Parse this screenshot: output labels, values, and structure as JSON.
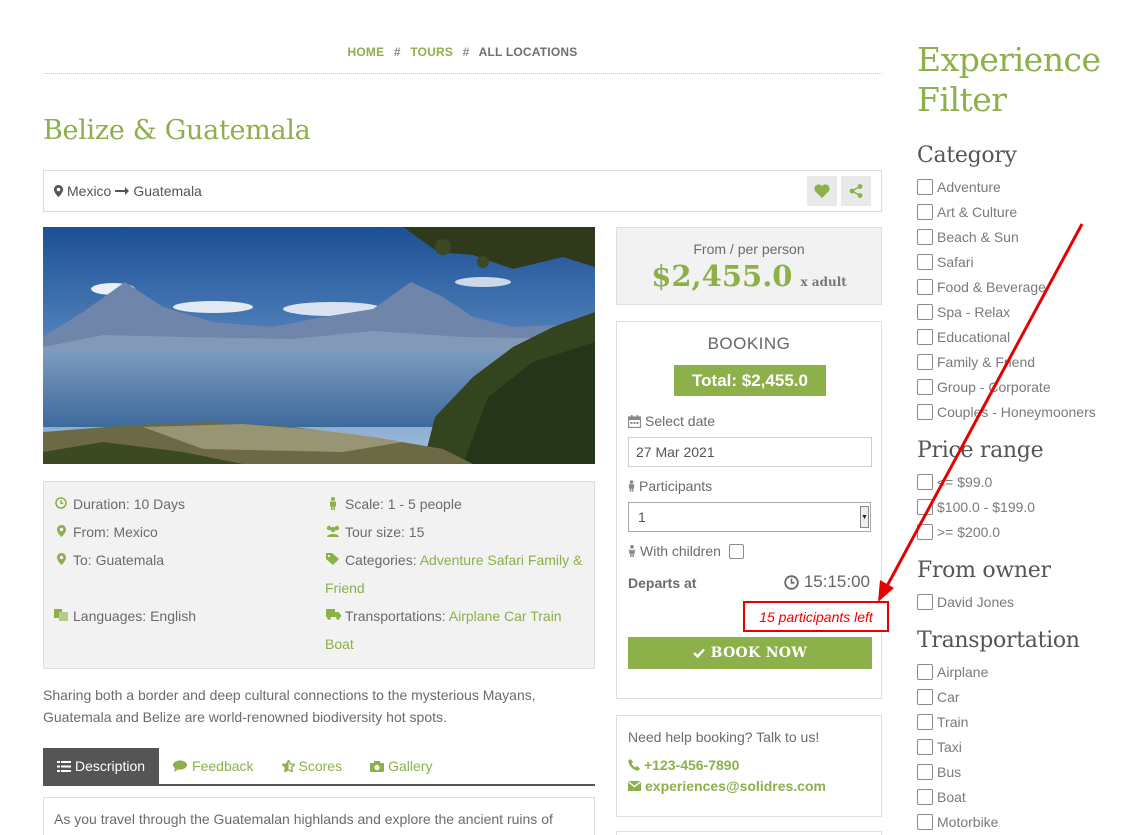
{
  "breadcrumb": {
    "home": "HOME",
    "sep": "#",
    "tours": "TOURS",
    "current": "ALL LOCATIONS"
  },
  "tour": {
    "title": "Belize & Guatemala",
    "route_from": "Mexico",
    "route_to": "Guatemala",
    "facts": {
      "duration": "Duration: 10 Days",
      "from": "From: Mexico",
      "to": "To: Guatemala",
      "languages": "Languages: English",
      "scale": "Scale: 1 - 5 people",
      "tour_size": "Tour size: 15",
      "categories_label": "Categories:",
      "categories_line1": "Adventure Safari Family &",
      "categories_line2": "Friend",
      "transport_label": "Transportations:",
      "transport_line1": "Airplane Car Train",
      "transport_line2": "Boat"
    },
    "intro_line1": "Sharing both a border and deep cultural connections to the mysterious Mayans,",
    "intro_line2": "Guatemala and Belize are world-renowned biodiversity hot spots.",
    "tabs": [
      "Description",
      "Feedback",
      "Scores",
      "Gallery"
    ],
    "description_start": "As you travel through the Guatemalan highlands and explore the ancient ruins of"
  },
  "price": {
    "from_label": "From / per person",
    "amount": "$2,455.0",
    "unit": "x adult"
  },
  "booking": {
    "title": "BOOKING",
    "total": "Total: $2,455.0",
    "select_date_label": "Select date",
    "date_value": "27 Mar 2021",
    "participants_label": "Participants",
    "participants_value": "1",
    "children_label": "With children",
    "departs_label": "Departs at",
    "departs_time": "15:15:00",
    "participants_left": "15 participants left",
    "book_now": "BOOK NOW"
  },
  "help": {
    "question": "Need help booking? Talk to us!",
    "phone": "+123-456-7890",
    "email": "experiences@solidres.com"
  },
  "filter": {
    "title_line1": "Experience",
    "title_line2": "Filter",
    "category_heading": "Category",
    "categories": [
      "Adventure",
      "Art & Culture",
      "Beach & Sun",
      "Safari",
      "Food & Beverage",
      "Spa - Relax",
      "Educational",
      "Family & Friend",
      "Group - Corporate",
      "Couples - Honeymooners"
    ],
    "price_heading": "Price range",
    "prices": [
      "<= $99.0",
      "$100.0 - $199.0",
      ">= $200.0"
    ],
    "owner_heading": "From owner",
    "owners": [
      "David Jones"
    ],
    "transport_heading": "Transportation",
    "transports": [
      "Airplane",
      "Car",
      "Train",
      "Taxi",
      "Bus",
      "Boat",
      "Motorbike"
    ]
  },
  "colors": {
    "accent": "#8cb04a",
    "annotation": "#e60000",
    "text": "#555555"
  }
}
